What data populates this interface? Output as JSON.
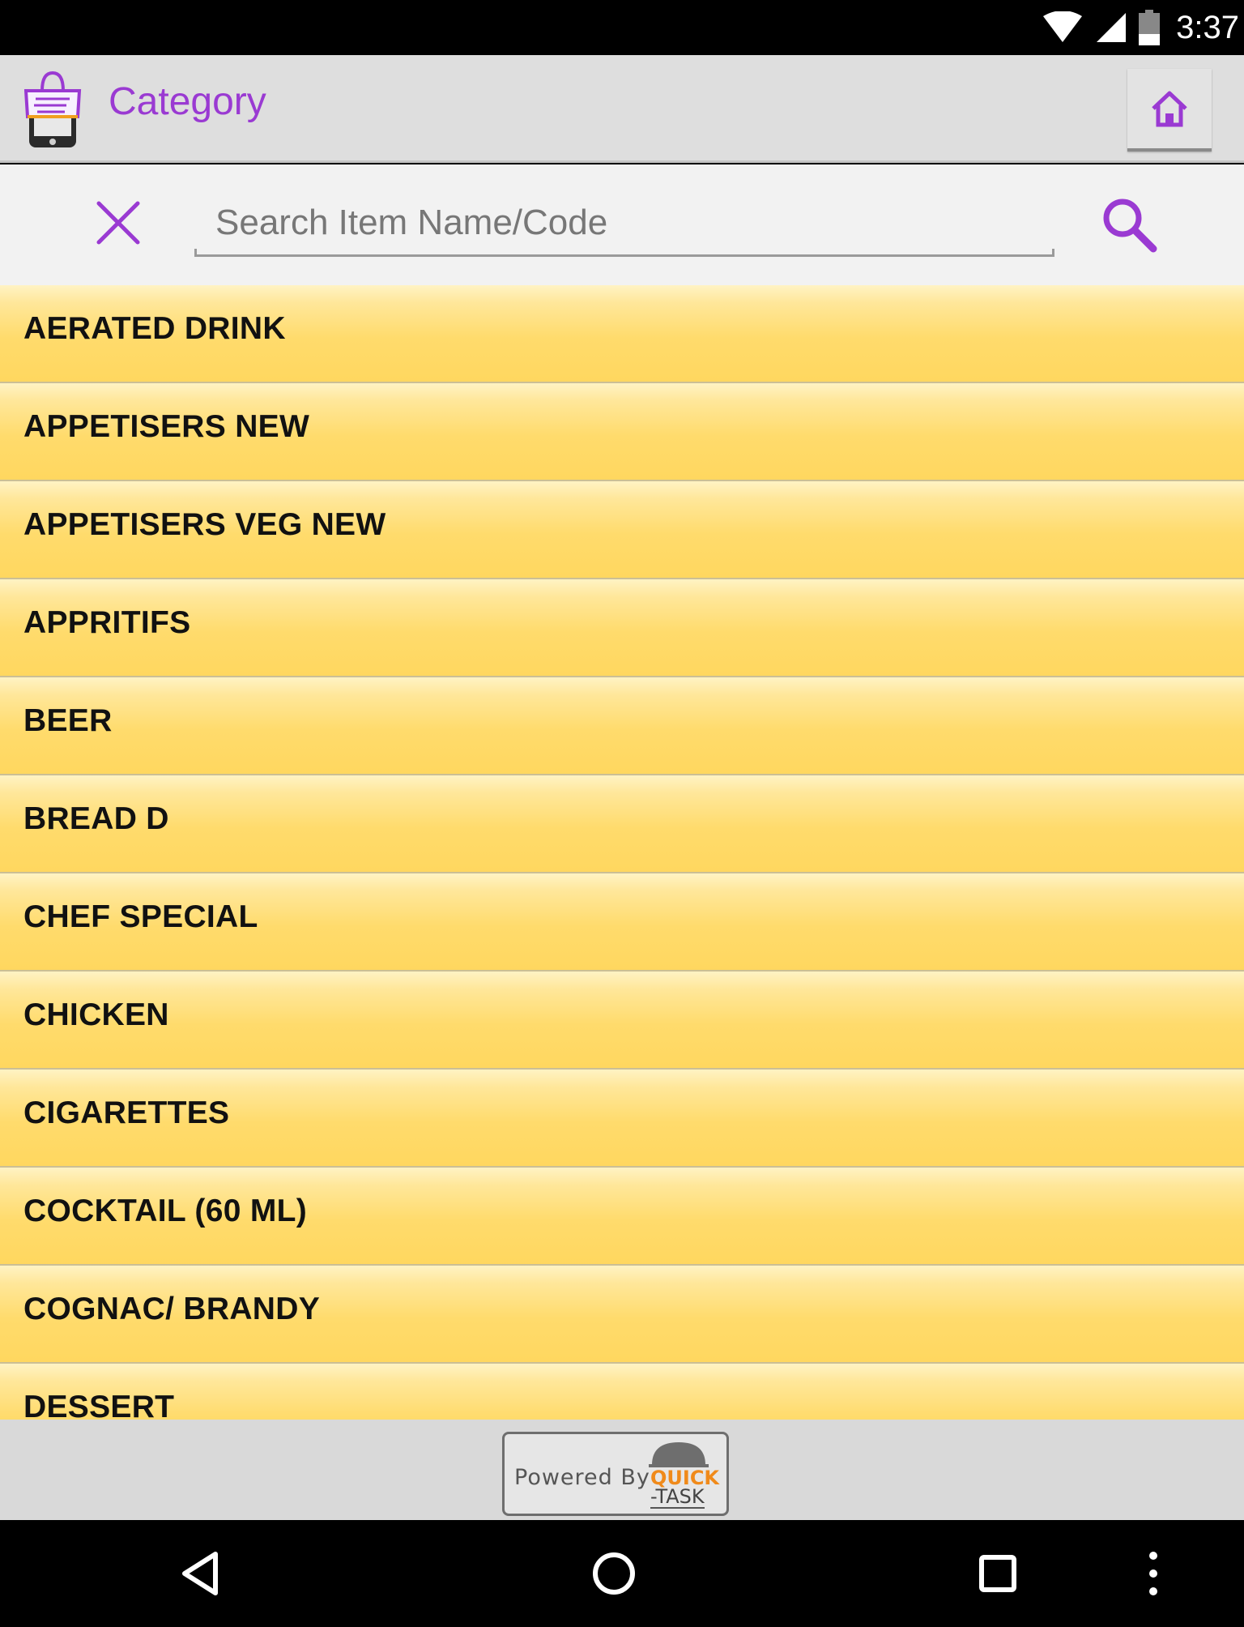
{
  "status_bar": {
    "time": "3:37",
    "icons": [
      "wifi-icon",
      "signal-icon",
      "battery-icon"
    ]
  },
  "app_bar": {
    "title": "Category",
    "logo_icon": "shopping-bag-phone-icon",
    "home_icon": "home-icon"
  },
  "search": {
    "placeholder": "Search Item Name/Code",
    "value": "",
    "clear_icon": "close-icon",
    "search_icon": "search-icon"
  },
  "categories": [
    "AERATED DRINK",
    "APPETISERS NEW",
    "APPETISERS VEG NEW",
    "APPRITIFS",
    "BEER",
    "BREAD D",
    "CHEF SPECIAL",
    "CHICKEN",
    "CIGARETTES",
    "COCKTAIL (60 ML)",
    "COGNAC/ BRANDY",
    "DESSERT"
  ],
  "footer": {
    "powered_by": "Powered By",
    "brand_line1": "QUICK",
    "brand_line2": "-TASK"
  },
  "nav_bar": {
    "icons": [
      "back-icon",
      "home-circle-icon",
      "recents-icon",
      "overflow-menu-icon"
    ]
  },
  "colors": {
    "accent": "#9a3ad2",
    "row_yellow": "#ffd75f",
    "brand_orange": "#f08a1a"
  }
}
